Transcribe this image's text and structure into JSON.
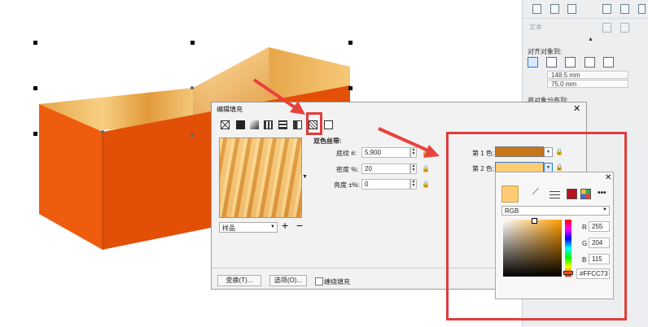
{
  "docker": {
    "text_label": "文本",
    "align_to_label": "对齐对象到:",
    "x_value": "148.5 mm",
    "y_value": "75.0 mm",
    "distribute_label": "将对象分布到:"
  },
  "dialog": {
    "title": "编辑填充",
    "section_title": "双色丝带:",
    "preview_select": "样品",
    "params": [
      {
        "label": "底纹 #:",
        "value": "5,900"
      },
      {
        "label": "密度 %:",
        "value": "20"
      },
      {
        "label": "亮度 ±%:",
        "value": "0"
      }
    ],
    "color1_label": "第 1 色:",
    "color2_label": "第 2 色:",
    "color1": "#c8761a",
    "color2": "#ffcc73",
    "transform_button": "变换(T)...",
    "options_button": "选项(O)...",
    "wrap_checkbox": "缠绕填充",
    "close_symbol": "✕"
  },
  "picker": {
    "close_symbol": "✕",
    "model": "RGB",
    "r": "255",
    "g": "204",
    "b": "115",
    "hex": "#FFCC73",
    "r_label": "R",
    "g_label": "G",
    "b_label": "B"
  },
  "colors": {
    "box_orange": "#ec5a0b",
    "highlight_red": "#e23b3b",
    "arrow_red": "#e8423c"
  },
  "icons": [
    "eyedropper-icon",
    "sliders-icon",
    "palette-icon",
    "grid-icon",
    "more-icon",
    "lock-icon",
    "plus-icon",
    "minus-icon"
  ]
}
